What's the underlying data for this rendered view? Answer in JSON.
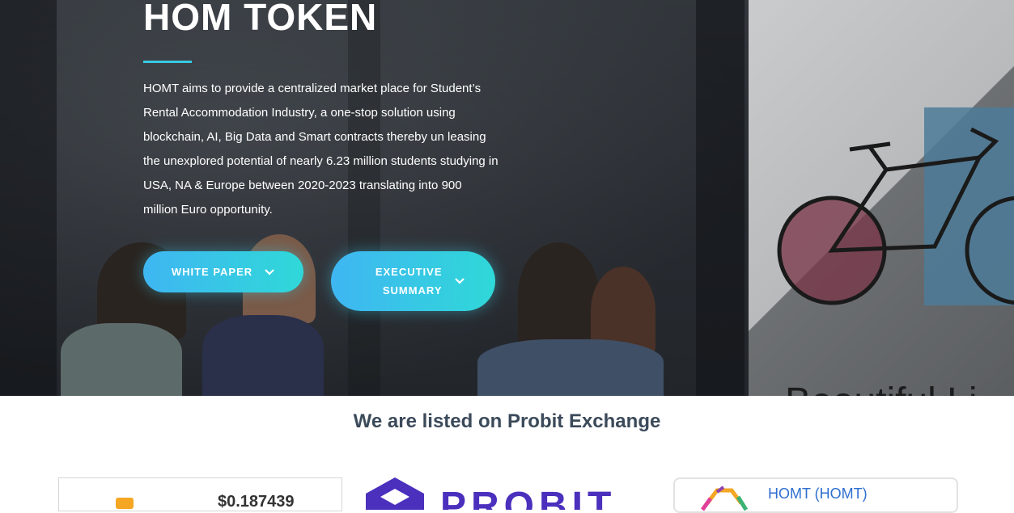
{
  "hero": {
    "title": "HOM TOKEN",
    "description": "HOMT aims to provide a centralized market place for Student’s Rental Accommodation Industry, a one-stop solution using blockchain, AI, Big Data and Smart contracts thereby un leasing the unexplored potential of nearly 6.23 million students studying in USA, NA & Europe between 2020-2023 translating into 900 million Euro opportunity.",
    "buttons": {
      "white_paper": "WHITE PAPER",
      "executive_summary": "EXECUTIVE SUMMARY"
    },
    "accent_color": "#38c9e0"
  },
  "listing": {
    "title": "We are listed on Probit Exchange",
    "price_card": {
      "price": "$0.187439"
    },
    "exchange_logo_text": "PROBIT",
    "pair_card": {
      "pair": "HOMT (HOMT)"
    }
  }
}
